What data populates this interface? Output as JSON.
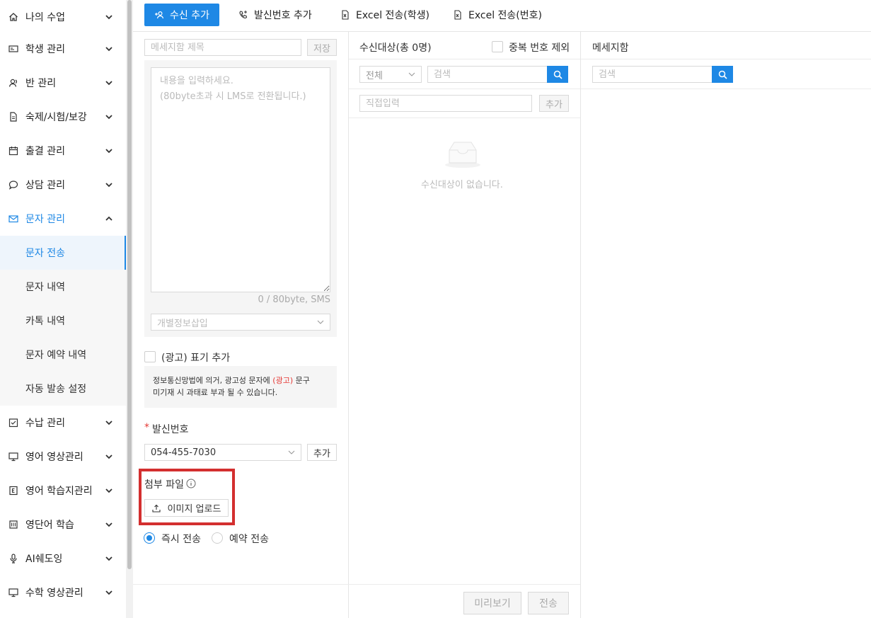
{
  "sidebar": {
    "items": [
      {
        "label": "나의 수업",
        "icon": "home-icon"
      },
      {
        "label": "학생 관리",
        "icon": "id-card-icon"
      },
      {
        "label": "반 관리",
        "icon": "users-icon"
      },
      {
        "label": "숙제/시험/보강",
        "icon": "document-icon"
      },
      {
        "label": "출결 관리",
        "icon": "calendar-icon"
      },
      {
        "label": "상담 관리",
        "icon": "chat-icon"
      },
      {
        "label": "문자 관리",
        "icon": "mail-icon"
      },
      {
        "label": "수납 관리",
        "icon": "check-box-icon"
      },
      {
        "label": "영어 영상관리",
        "icon": "monitor-icon"
      },
      {
        "label": "영어 학습지관리",
        "icon": "e-box-icon"
      },
      {
        "label": "영단어 학습",
        "icon": "keyboard-icon"
      },
      {
        "label": "AI쉐도잉",
        "icon": "microphone-icon"
      },
      {
        "label": "수학 영상관리",
        "icon": "monitor-icon"
      }
    ],
    "sub_items": [
      "문자 전송",
      "문자 내역",
      "카톡 내역",
      "문자 예약 내역",
      "자동 발송 설정"
    ]
  },
  "toolbar": {
    "add_recipient": "수신 추가",
    "add_sender": "발신번호 추가",
    "excel_student": "Excel 전송(학생)",
    "excel_number": "Excel 전송(번호)"
  },
  "compose": {
    "title_placeholder": "메세지함 제목",
    "save_label": "저장",
    "content_placeholder": "내용을 입력하세요.\n(80byte초과 시 LMS로 전환됩니다.)",
    "byte_count": "0 / 80byte, SMS",
    "personal_insert_placeholder": "개별정보삽입",
    "ad_checkbox_label": "(광고) 표기 추가",
    "notice_part1": "정보통신망법에 의거, 광고성 문자에 ",
    "notice_red": "(광고)",
    "notice_part2": " 문구",
    "notice_line2": "미기재 시 과태료 부과 될 수 있습니다.",
    "sender_required_mark": "*",
    "sender_label": "발신번호",
    "sender_number": "054-455-7030",
    "sender_add": "추가",
    "attach_label": "첨부 파일",
    "upload_label": "이미지 업로드",
    "send_now": "즉시 전송",
    "send_scheduled": "예약 전송",
    "preview_label": "미리보기",
    "send_label": "전송"
  },
  "recipients": {
    "title": "수신대상(총 0명)",
    "dedupe_label": "중복 번호 제외",
    "filter_value": "전체",
    "search_placeholder": "검색",
    "direct_placeholder": "직접입력",
    "add_label": "추가",
    "empty_text": "수신대상이 없습니다."
  },
  "messagebox": {
    "title": "메세지함",
    "search_placeholder": "검색"
  },
  "colors": {
    "accent": "#1e88e5",
    "highlight": "#d32f2f",
    "warning": "#e53935"
  }
}
